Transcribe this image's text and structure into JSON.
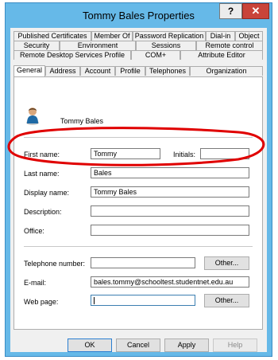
{
  "window": {
    "title": "Tommy Bales Properties",
    "help_label": "?",
    "close_label": "✕"
  },
  "tabs": {
    "row1": [
      "Published Certificates",
      "Member Of",
      "Password Replication",
      "Dial-in",
      "Object"
    ],
    "row2": [
      "Security",
      "Environment",
      "Sessions",
      "Remote control"
    ],
    "row3": [
      "Remote Desktop Services Profile",
      "COM+",
      "Attribute Editor"
    ],
    "row4": [
      "General",
      "Address",
      "Account",
      "Profile",
      "Telephones",
      "Organization"
    ],
    "active": "General"
  },
  "general": {
    "display_header": "Tommy Bales",
    "first_name_label": "First name:",
    "first_name_value": "Tommy",
    "initials_label": "Initials:",
    "initials_value": "",
    "last_name_label": "Last name:",
    "last_name_value": "Bales",
    "display_name_label": "Display name:",
    "display_name_value": "Tommy Bales",
    "description_label": "Description:",
    "description_value": "",
    "office_label": "Office:",
    "office_value": "",
    "telephone_label": "Telephone number:",
    "telephone_value": "",
    "telephone_other_label": "Other...",
    "email_label": "E-mail:",
    "email_value": "bales.tommy@schooltest.studentnet.edu.au",
    "webpage_label": "Web page:",
    "webpage_value": "",
    "webpage_other_label": "Other..."
  },
  "footer": {
    "ok_label": "OK",
    "cancel_label": "Cancel",
    "apply_label": "Apply",
    "help_label": "Help"
  },
  "colors": {
    "titlebar": "#66b9e8",
    "close_button": "#c9443a",
    "annotation": "#e00000"
  },
  "icons": {
    "user": "user-icon"
  }
}
